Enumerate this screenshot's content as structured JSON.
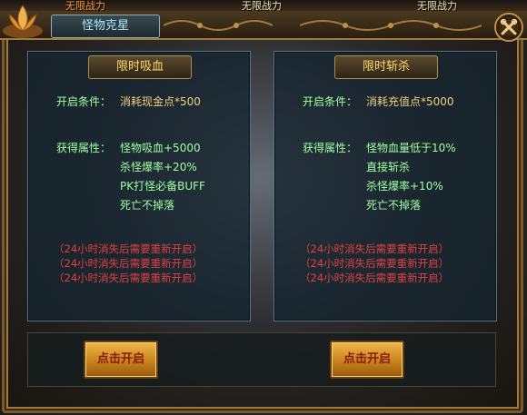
{
  "topbar": {
    "tab1": "无限战力",
    "tab2": "无限战力",
    "tab3": "无限战力"
  },
  "window": {
    "title": "怪物克星"
  },
  "panels": [
    {
      "title": "限时吸血",
      "condition_label": "开启条件：",
      "condition_value": "消耗现金点*500",
      "attr_label": "获得属性：",
      "attrs": [
        "怪物吸血+5000",
        "杀怪爆率+20%",
        "PK打怪必备BUFF",
        "死亡不掉落"
      ],
      "notes": [
        "（24小时消失后需要重新开启）",
        "（24小时消失后需要重新开启）",
        "（24小时消失后需要重新开启）"
      ],
      "button": "点击开启"
    },
    {
      "title": "限时斩杀",
      "condition_label": "开启条件：",
      "condition_value": "消耗充值点*5000",
      "attr_label": "获得属性：",
      "attrs": [
        "怪物血量低于10%",
        "直接斩杀",
        "杀怪爆率+10%",
        "死亡不掉落"
      ],
      "notes": [
        "（24小时消失后需要重新开启）",
        "（24小时消失后需要重新开启）",
        "（24小时消失后需要重新开启）"
      ],
      "button": "点击开启"
    }
  ],
  "icons": {
    "logo": "lotus-icon",
    "close": "wrench-close-icon"
  }
}
